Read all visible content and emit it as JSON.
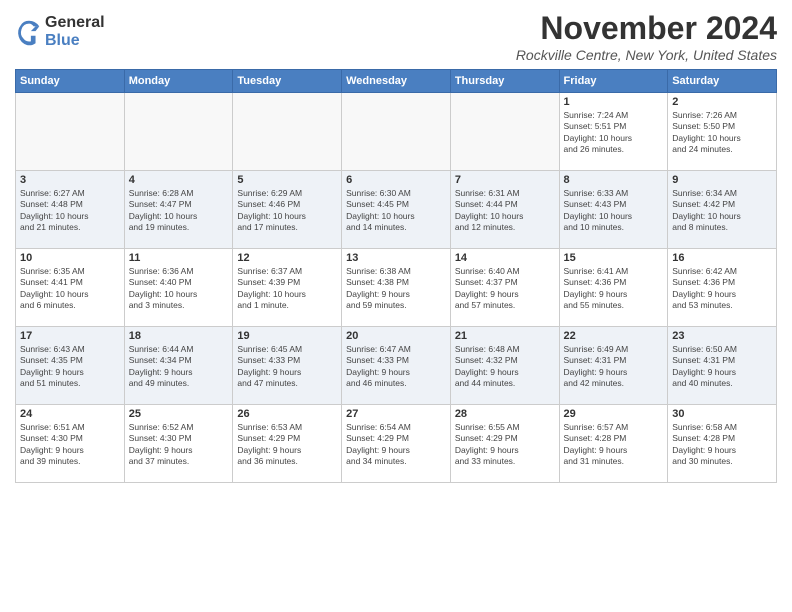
{
  "header": {
    "logo_line1": "General",
    "logo_line2": "Blue",
    "month_title": "November 2024",
    "location": "Rockville Centre, New York, United States"
  },
  "weekdays": [
    "Sunday",
    "Monday",
    "Tuesday",
    "Wednesday",
    "Thursday",
    "Friday",
    "Saturday"
  ],
  "weeks": [
    [
      {
        "day": "",
        "info": ""
      },
      {
        "day": "",
        "info": ""
      },
      {
        "day": "",
        "info": ""
      },
      {
        "day": "",
        "info": ""
      },
      {
        "day": "",
        "info": ""
      },
      {
        "day": "1",
        "info": "Sunrise: 7:24 AM\nSunset: 5:51 PM\nDaylight: 10 hours\nand 26 minutes."
      },
      {
        "day": "2",
        "info": "Sunrise: 7:26 AM\nSunset: 5:50 PM\nDaylight: 10 hours\nand 24 minutes."
      }
    ],
    [
      {
        "day": "3",
        "info": "Sunrise: 6:27 AM\nSunset: 4:48 PM\nDaylight: 10 hours\nand 21 minutes."
      },
      {
        "day": "4",
        "info": "Sunrise: 6:28 AM\nSunset: 4:47 PM\nDaylight: 10 hours\nand 19 minutes."
      },
      {
        "day": "5",
        "info": "Sunrise: 6:29 AM\nSunset: 4:46 PM\nDaylight: 10 hours\nand 17 minutes."
      },
      {
        "day": "6",
        "info": "Sunrise: 6:30 AM\nSunset: 4:45 PM\nDaylight: 10 hours\nand 14 minutes."
      },
      {
        "day": "7",
        "info": "Sunrise: 6:31 AM\nSunset: 4:44 PM\nDaylight: 10 hours\nand 12 minutes."
      },
      {
        "day": "8",
        "info": "Sunrise: 6:33 AM\nSunset: 4:43 PM\nDaylight: 10 hours\nand 10 minutes."
      },
      {
        "day": "9",
        "info": "Sunrise: 6:34 AM\nSunset: 4:42 PM\nDaylight: 10 hours\nand 8 minutes."
      }
    ],
    [
      {
        "day": "10",
        "info": "Sunrise: 6:35 AM\nSunset: 4:41 PM\nDaylight: 10 hours\nand 6 minutes."
      },
      {
        "day": "11",
        "info": "Sunrise: 6:36 AM\nSunset: 4:40 PM\nDaylight: 10 hours\nand 3 minutes."
      },
      {
        "day": "12",
        "info": "Sunrise: 6:37 AM\nSunset: 4:39 PM\nDaylight: 10 hours\nand 1 minute."
      },
      {
        "day": "13",
        "info": "Sunrise: 6:38 AM\nSunset: 4:38 PM\nDaylight: 9 hours\nand 59 minutes."
      },
      {
        "day": "14",
        "info": "Sunrise: 6:40 AM\nSunset: 4:37 PM\nDaylight: 9 hours\nand 57 minutes."
      },
      {
        "day": "15",
        "info": "Sunrise: 6:41 AM\nSunset: 4:36 PM\nDaylight: 9 hours\nand 55 minutes."
      },
      {
        "day": "16",
        "info": "Sunrise: 6:42 AM\nSunset: 4:36 PM\nDaylight: 9 hours\nand 53 minutes."
      }
    ],
    [
      {
        "day": "17",
        "info": "Sunrise: 6:43 AM\nSunset: 4:35 PM\nDaylight: 9 hours\nand 51 minutes."
      },
      {
        "day": "18",
        "info": "Sunrise: 6:44 AM\nSunset: 4:34 PM\nDaylight: 9 hours\nand 49 minutes."
      },
      {
        "day": "19",
        "info": "Sunrise: 6:45 AM\nSunset: 4:33 PM\nDaylight: 9 hours\nand 47 minutes."
      },
      {
        "day": "20",
        "info": "Sunrise: 6:47 AM\nSunset: 4:33 PM\nDaylight: 9 hours\nand 46 minutes."
      },
      {
        "day": "21",
        "info": "Sunrise: 6:48 AM\nSunset: 4:32 PM\nDaylight: 9 hours\nand 44 minutes."
      },
      {
        "day": "22",
        "info": "Sunrise: 6:49 AM\nSunset: 4:31 PM\nDaylight: 9 hours\nand 42 minutes."
      },
      {
        "day": "23",
        "info": "Sunrise: 6:50 AM\nSunset: 4:31 PM\nDaylight: 9 hours\nand 40 minutes."
      }
    ],
    [
      {
        "day": "24",
        "info": "Sunrise: 6:51 AM\nSunset: 4:30 PM\nDaylight: 9 hours\nand 39 minutes."
      },
      {
        "day": "25",
        "info": "Sunrise: 6:52 AM\nSunset: 4:30 PM\nDaylight: 9 hours\nand 37 minutes."
      },
      {
        "day": "26",
        "info": "Sunrise: 6:53 AM\nSunset: 4:29 PM\nDaylight: 9 hours\nand 36 minutes."
      },
      {
        "day": "27",
        "info": "Sunrise: 6:54 AM\nSunset: 4:29 PM\nDaylight: 9 hours\nand 34 minutes."
      },
      {
        "day": "28",
        "info": "Sunrise: 6:55 AM\nSunset: 4:29 PM\nDaylight: 9 hours\nand 33 minutes."
      },
      {
        "day": "29",
        "info": "Sunrise: 6:57 AM\nSunset: 4:28 PM\nDaylight: 9 hours\nand 31 minutes."
      },
      {
        "day": "30",
        "info": "Sunrise: 6:58 AM\nSunset: 4:28 PM\nDaylight: 9 hours\nand 30 minutes."
      }
    ]
  ]
}
